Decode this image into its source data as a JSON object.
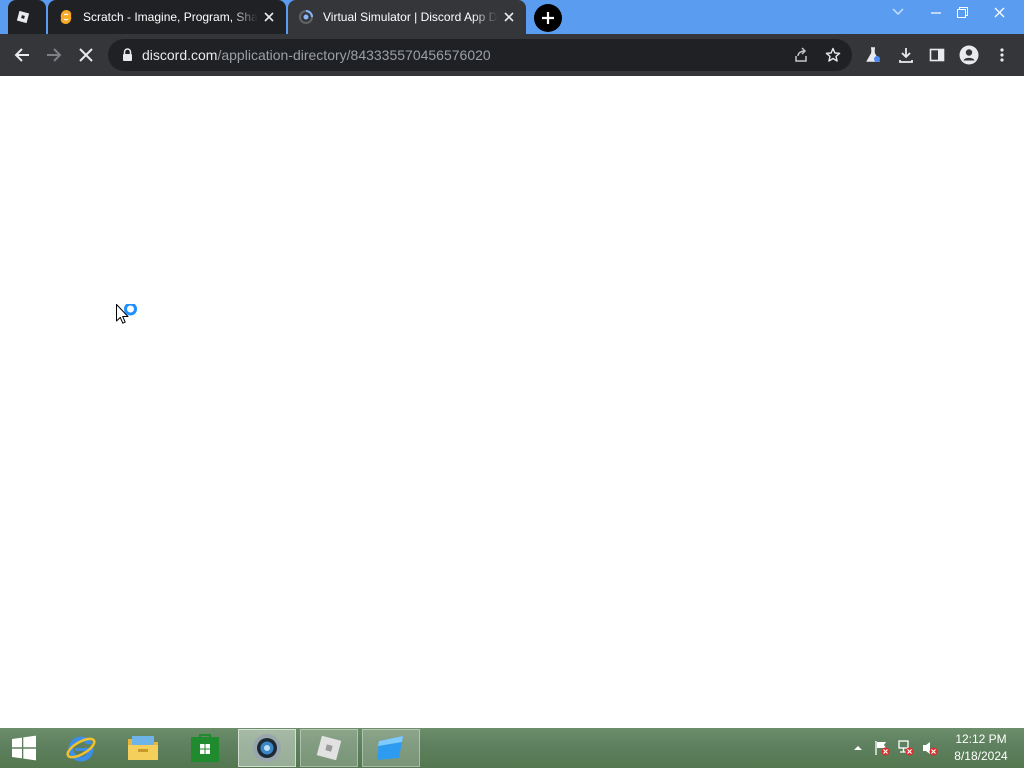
{
  "browser": {
    "tabs": [
      {
        "title": "",
        "favicon": "roblox-icon",
        "pinned": true
      },
      {
        "title": "Scratch - Imagine, Program, Share",
        "favicon": "scratch-icon"
      },
      {
        "title": "Virtual Simulator | Discord App Directory",
        "favicon": "discord-loading-icon",
        "active": true
      }
    ],
    "address": {
      "host": "discord.com",
      "path": "/application-directory/843335570456576020"
    }
  },
  "taskbar": {
    "apps": [
      {
        "name": "internet-explorer-icon"
      },
      {
        "name": "file-explorer-icon"
      },
      {
        "name": "store-icon"
      },
      {
        "name": "chrome-icon",
        "active": true
      },
      {
        "name": "roblox-icon",
        "running": true
      },
      {
        "name": "roblox-studio-icon",
        "running": true
      }
    ],
    "clock": {
      "time": "12:12 PM",
      "date": "8/18/2024"
    }
  },
  "colors": {
    "tabstrip": "#5a9cf0",
    "toolbar": "#35363a",
    "omnibox": "#202124",
    "busy_cursor": "#1e90ff"
  }
}
